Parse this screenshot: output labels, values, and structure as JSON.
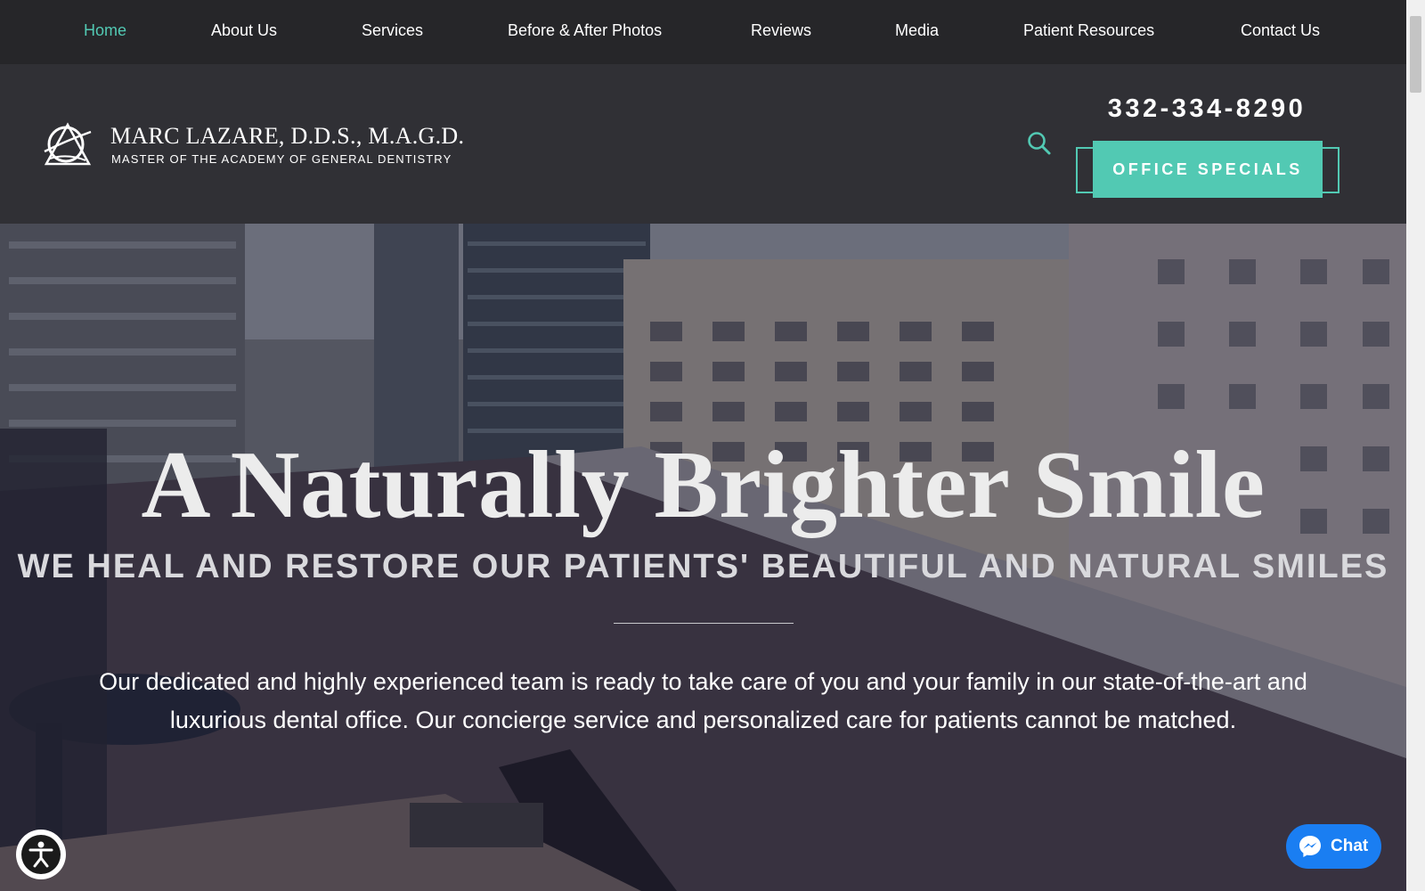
{
  "nav": {
    "items": [
      {
        "label": "Home",
        "active": true
      },
      {
        "label": "About Us"
      },
      {
        "label": "Services"
      },
      {
        "label": "Before & After Photos"
      },
      {
        "label": "Reviews"
      },
      {
        "label": "Media"
      },
      {
        "label": "Patient Resources"
      },
      {
        "label": "Contact Us"
      }
    ]
  },
  "header": {
    "logo_name": "MARC LAZARE, D.D.S., M.A.G.D.",
    "logo_tagline": "MASTER OF THE ACADEMY OF GENERAL DENTISTRY",
    "phone": "332-334-8290",
    "specials_button": "OFFICE SPECIALS",
    "search_icon": "search-icon"
  },
  "hero": {
    "title": "A Naturally Brighter Smile",
    "subtitle": "WE HEAL AND RESTORE OUR PATIENTS' BEAUTIFUL AND NATURAL SMILES",
    "body": "Our dedicated and highly experienced team is ready to take care of you and your family in our state-of-the-art and luxurious dental office. Our concierge service and personalized care for patients cannot be matched."
  },
  "widgets": {
    "chat_label": "Chat",
    "chat_icon": "messenger-icon",
    "accessibility_icon": "accessibility-icon"
  },
  "colors": {
    "accent": "#52c9b3",
    "nav_bg": "#262629",
    "header_bg": "#303035",
    "chat_blue": "#1a7ef2"
  }
}
